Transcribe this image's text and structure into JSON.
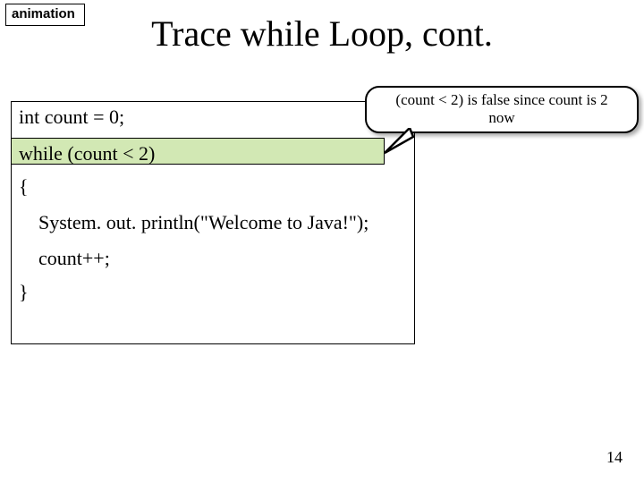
{
  "animation_label": "animation",
  "title": "Trace while Loop, cont.",
  "callout": {
    "line1": "(count < 2) is false since count is 2",
    "line2": "now"
  },
  "code": {
    "line1": "int count = 0;",
    "line2": "while (count < 2)",
    "line3": "{",
    "line4": "System. out. println(\"Welcome to Java!\");",
    "line5": "count++;",
    "line6": "}"
  },
  "page_number": "14"
}
